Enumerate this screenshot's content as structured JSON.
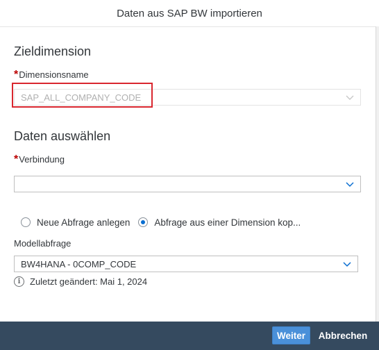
{
  "dialog": {
    "title": "Daten aus SAP BW importieren"
  },
  "target": {
    "section_title": "Zieldimension",
    "dimension_label": "Dimensionsname",
    "dimension_value": "SAP_ALL_COMPANY_CODE"
  },
  "select_data": {
    "section_title": "Daten auswählen",
    "connection_label": "Verbindung",
    "connection_value": ""
  },
  "query_options": {
    "option_new": "Neue Abfrage anlegen",
    "option_copy": "Abfrage aus einer Dimension kop...",
    "selected": "option_copy"
  },
  "model_query": {
    "label": "Modellabfrage",
    "value": "BW4HANA - 0COMP_CODE"
  },
  "info": {
    "text": "Zuletzt geändert: Mai 1, 2024"
  },
  "footer": {
    "next_label": "Weiter",
    "cancel_label": "Abbrechen"
  },
  "colors": {
    "footer_bg": "#354a5f",
    "primary_button": "#4a90d9",
    "required_marker": "#bb0000",
    "highlight": "#d9262e"
  }
}
